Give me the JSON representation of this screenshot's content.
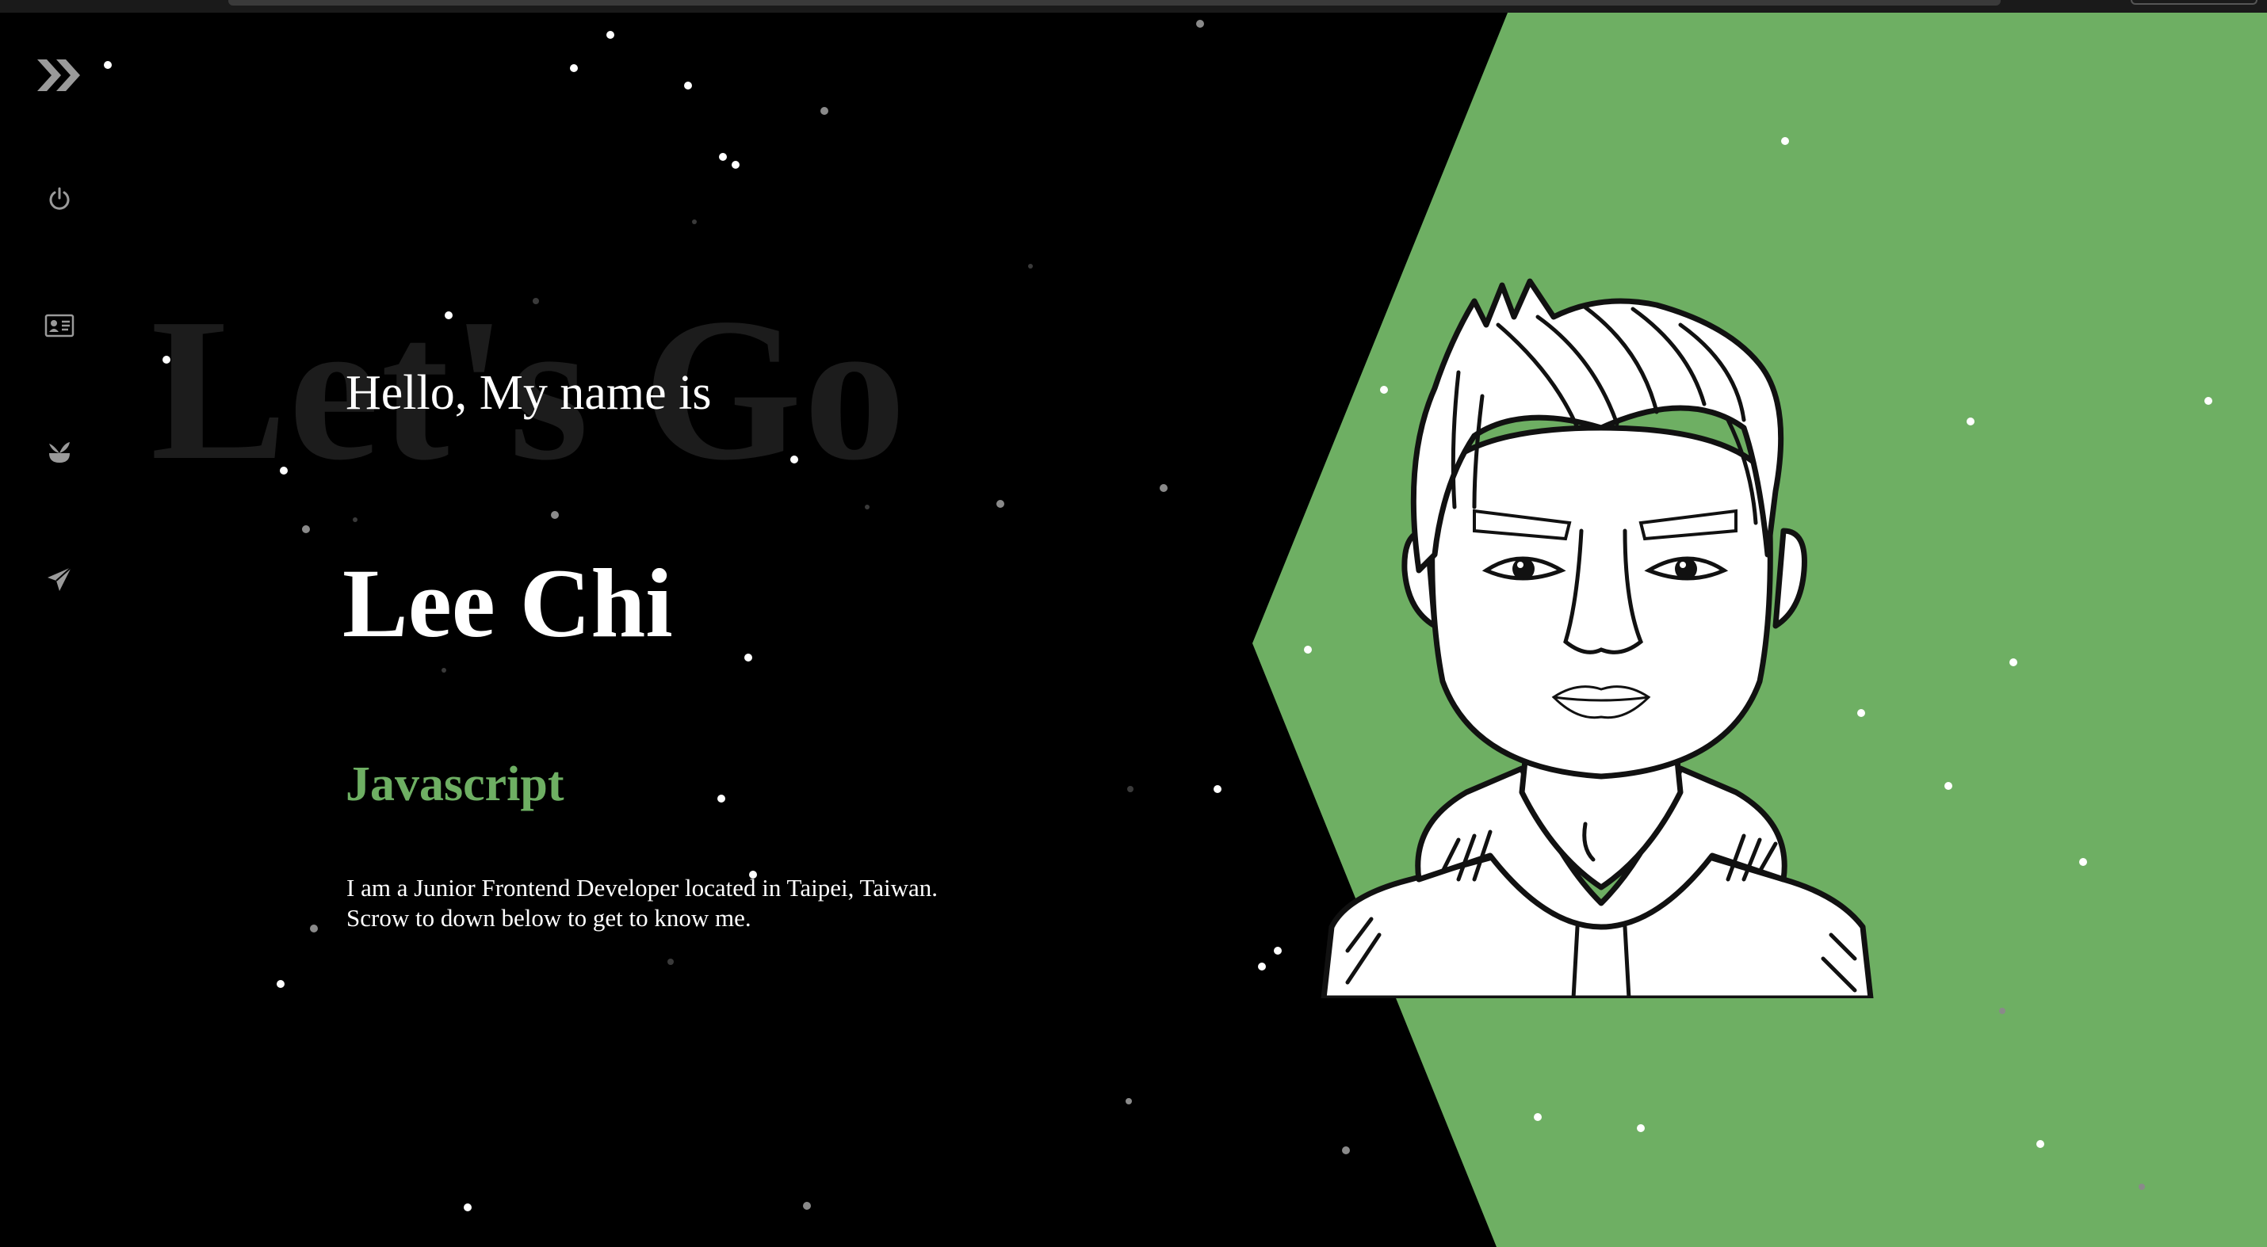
{
  "colors": {
    "accent": "#6eaf63",
    "background": "#000000",
    "watermark": "#1c1c1c",
    "sidebar_icon": "#9a9a9a"
  },
  "sidebar": {
    "items": [
      {
        "icon": "double-chevron-right-icon",
        "interactable": true
      },
      {
        "icon": "power-icon",
        "interactable": true
      },
      {
        "icon": "id-card-icon",
        "interactable": true
      },
      {
        "icon": "sprout-icon",
        "interactable": true
      },
      {
        "icon": "paper-plane-icon",
        "interactable": true
      }
    ]
  },
  "hero": {
    "watermark": "Let's Go",
    "greeting": "Hello, My name is",
    "name": "Lee Chi",
    "role": "Javascript",
    "bio_line1": "I am a Junior Frontend Developer located in Taipei, Taiwan.",
    "bio_line2": "Scrow to down below to get to know me."
  },
  "avatar": {
    "icon": "portrait-illustration"
  }
}
